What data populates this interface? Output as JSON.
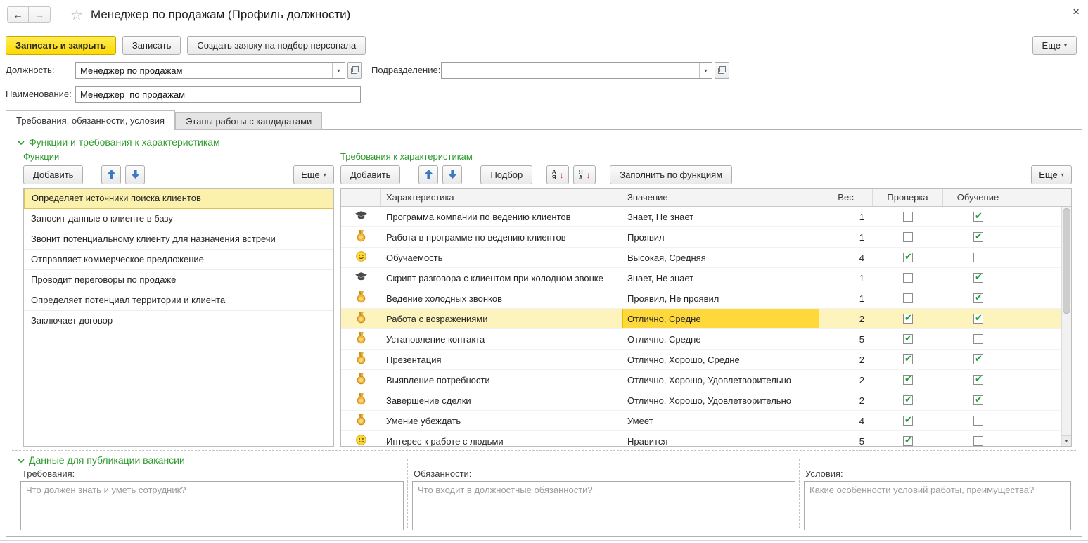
{
  "window": {
    "title": "Менеджер  по продажам (Профиль должности)"
  },
  "icons": {
    "back": "←",
    "forward": "→",
    "star": "☆",
    "close": "×",
    "caret": "▾",
    "sort_arrow": "↓",
    "sort_asc": [
      "А",
      "Я"
    ],
    "sort_desc": [
      "Я",
      "А"
    ],
    "scroll_down": "▼"
  },
  "command_bar": {
    "save_and_close": "Записать и закрыть",
    "save": "Записать",
    "create_recruitment_request": "Создать заявку на подбор персонала",
    "more": "Еще"
  },
  "form": {
    "position": {
      "label": "Должность:",
      "value": "Менеджер по продажам"
    },
    "department": {
      "label": "Подразделение:",
      "value": ""
    },
    "name": {
      "label": "Наименование:",
      "value": "Менеджер  по продажам"
    }
  },
  "tabs": [
    {
      "label": "Требования, обязанности, условия",
      "active": true
    },
    {
      "label": "Этапы работы с кандидатами",
      "active": false
    }
  ],
  "functions_section": {
    "title": "Функции и требования к характеристикам",
    "functions": {
      "title": "Функции",
      "toolbar": {
        "add": "Добавить",
        "more": "Еще"
      },
      "selected_index": 0,
      "items": [
        "Определяет источники поиска клиентов",
        "Заносит данные о клиенте в базу",
        "Звонит потенциальному клиенту для назначения встречи",
        "Отправляет коммерческое предложение",
        "Проводит переговоры по продаже",
        "Определяет потенциал территории и клиента",
        "Заключает договор"
      ]
    },
    "requirements": {
      "title": "Требования к характеристикам",
      "toolbar": {
        "add": "Добавить",
        "pick": "Подбор",
        "fill_by_functions": "Заполнить по функциям",
        "more": "Еще"
      },
      "columns": {
        "characteristic": "Характеристика",
        "value": "Значение",
        "weight": "Вес",
        "check": "Проверка",
        "training": "Обучение"
      },
      "rows": [
        {
          "icon": "graduation-cap",
          "name": "Программа компании по ведению клиентов",
          "value": "Знает, Не знает",
          "weight": 1,
          "check": false,
          "training": true,
          "selected": false
        },
        {
          "icon": "medal",
          "name": "Работа в программе по ведению клиентов",
          "value": "Проявил",
          "weight": 1,
          "check": false,
          "training": true,
          "selected": false
        },
        {
          "icon": "smiley",
          "name": "Обучаемость",
          "value": "Высокая, Средняя",
          "weight": 4,
          "check": true,
          "training": false,
          "selected": false
        },
        {
          "icon": "graduation-cap",
          "name": "Скрипт разговора с клиентом при холодном звонке",
          "value": "Знает, Не знает",
          "weight": 1,
          "check": false,
          "training": true,
          "selected": false
        },
        {
          "icon": "medal",
          "name": "Ведение холодных звонков",
          "value": "Проявил, Не проявил",
          "weight": 1,
          "check": false,
          "training": true,
          "selected": false
        },
        {
          "icon": "medal",
          "name": "Работа с возражениями",
          "value": "Отлично, Средне",
          "weight": 2,
          "check": true,
          "training": true,
          "selected": true
        },
        {
          "icon": "medal",
          "name": "Установление контакта",
          "value": "Отлично, Средне",
          "weight": 5,
          "check": true,
          "training": false,
          "selected": false
        },
        {
          "icon": "medal",
          "name": "Презентация",
          "value": "Отлично, Хорошо, Средне",
          "weight": 2,
          "check": true,
          "training": true,
          "selected": false
        },
        {
          "icon": "medal",
          "name": "Выявление потребности",
          "value": "Отлично, Хорошо, Удовлетворительно",
          "weight": 2,
          "check": true,
          "training": true,
          "selected": false
        },
        {
          "icon": "medal",
          "name": "Завершение сделки",
          "value": "Отлично, Хорошо, Удовлетворительно",
          "weight": 2,
          "check": true,
          "training": true,
          "selected": false
        },
        {
          "icon": "medal",
          "name": "Умение убеждать",
          "value": "Умеет",
          "weight": 4,
          "check": true,
          "training": false,
          "selected": false
        },
        {
          "icon": "smiley",
          "name": "Интерес к работе с людьми",
          "value": "Нравится",
          "weight": 5,
          "check": true,
          "training": false,
          "selected": false
        }
      ]
    }
  },
  "publication_section": {
    "title": "Данные для публикации вакансии",
    "fields": [
      {
        "label": "Требования:",
        "placeholder": "Что должен знать и уметь сотрудник?"
      },
      {
        "label": "Обязанности:",
        "placeholder": "Что входит в должностные обязанности?"
      },
      {
        "label": "Условия:",
        "placeholder": "Какие особенности условий работы, преимущества?"
      }
    ]
  },
  "colors": {
    "primary_button": "#FFDD00",
    "selection_row": "#FDF3BC",
    "active_cell": "#FFD83B",
    "section_title_green": "#2E9B2E",
    "checkmark_green": "#1F9E38"
  }
}
